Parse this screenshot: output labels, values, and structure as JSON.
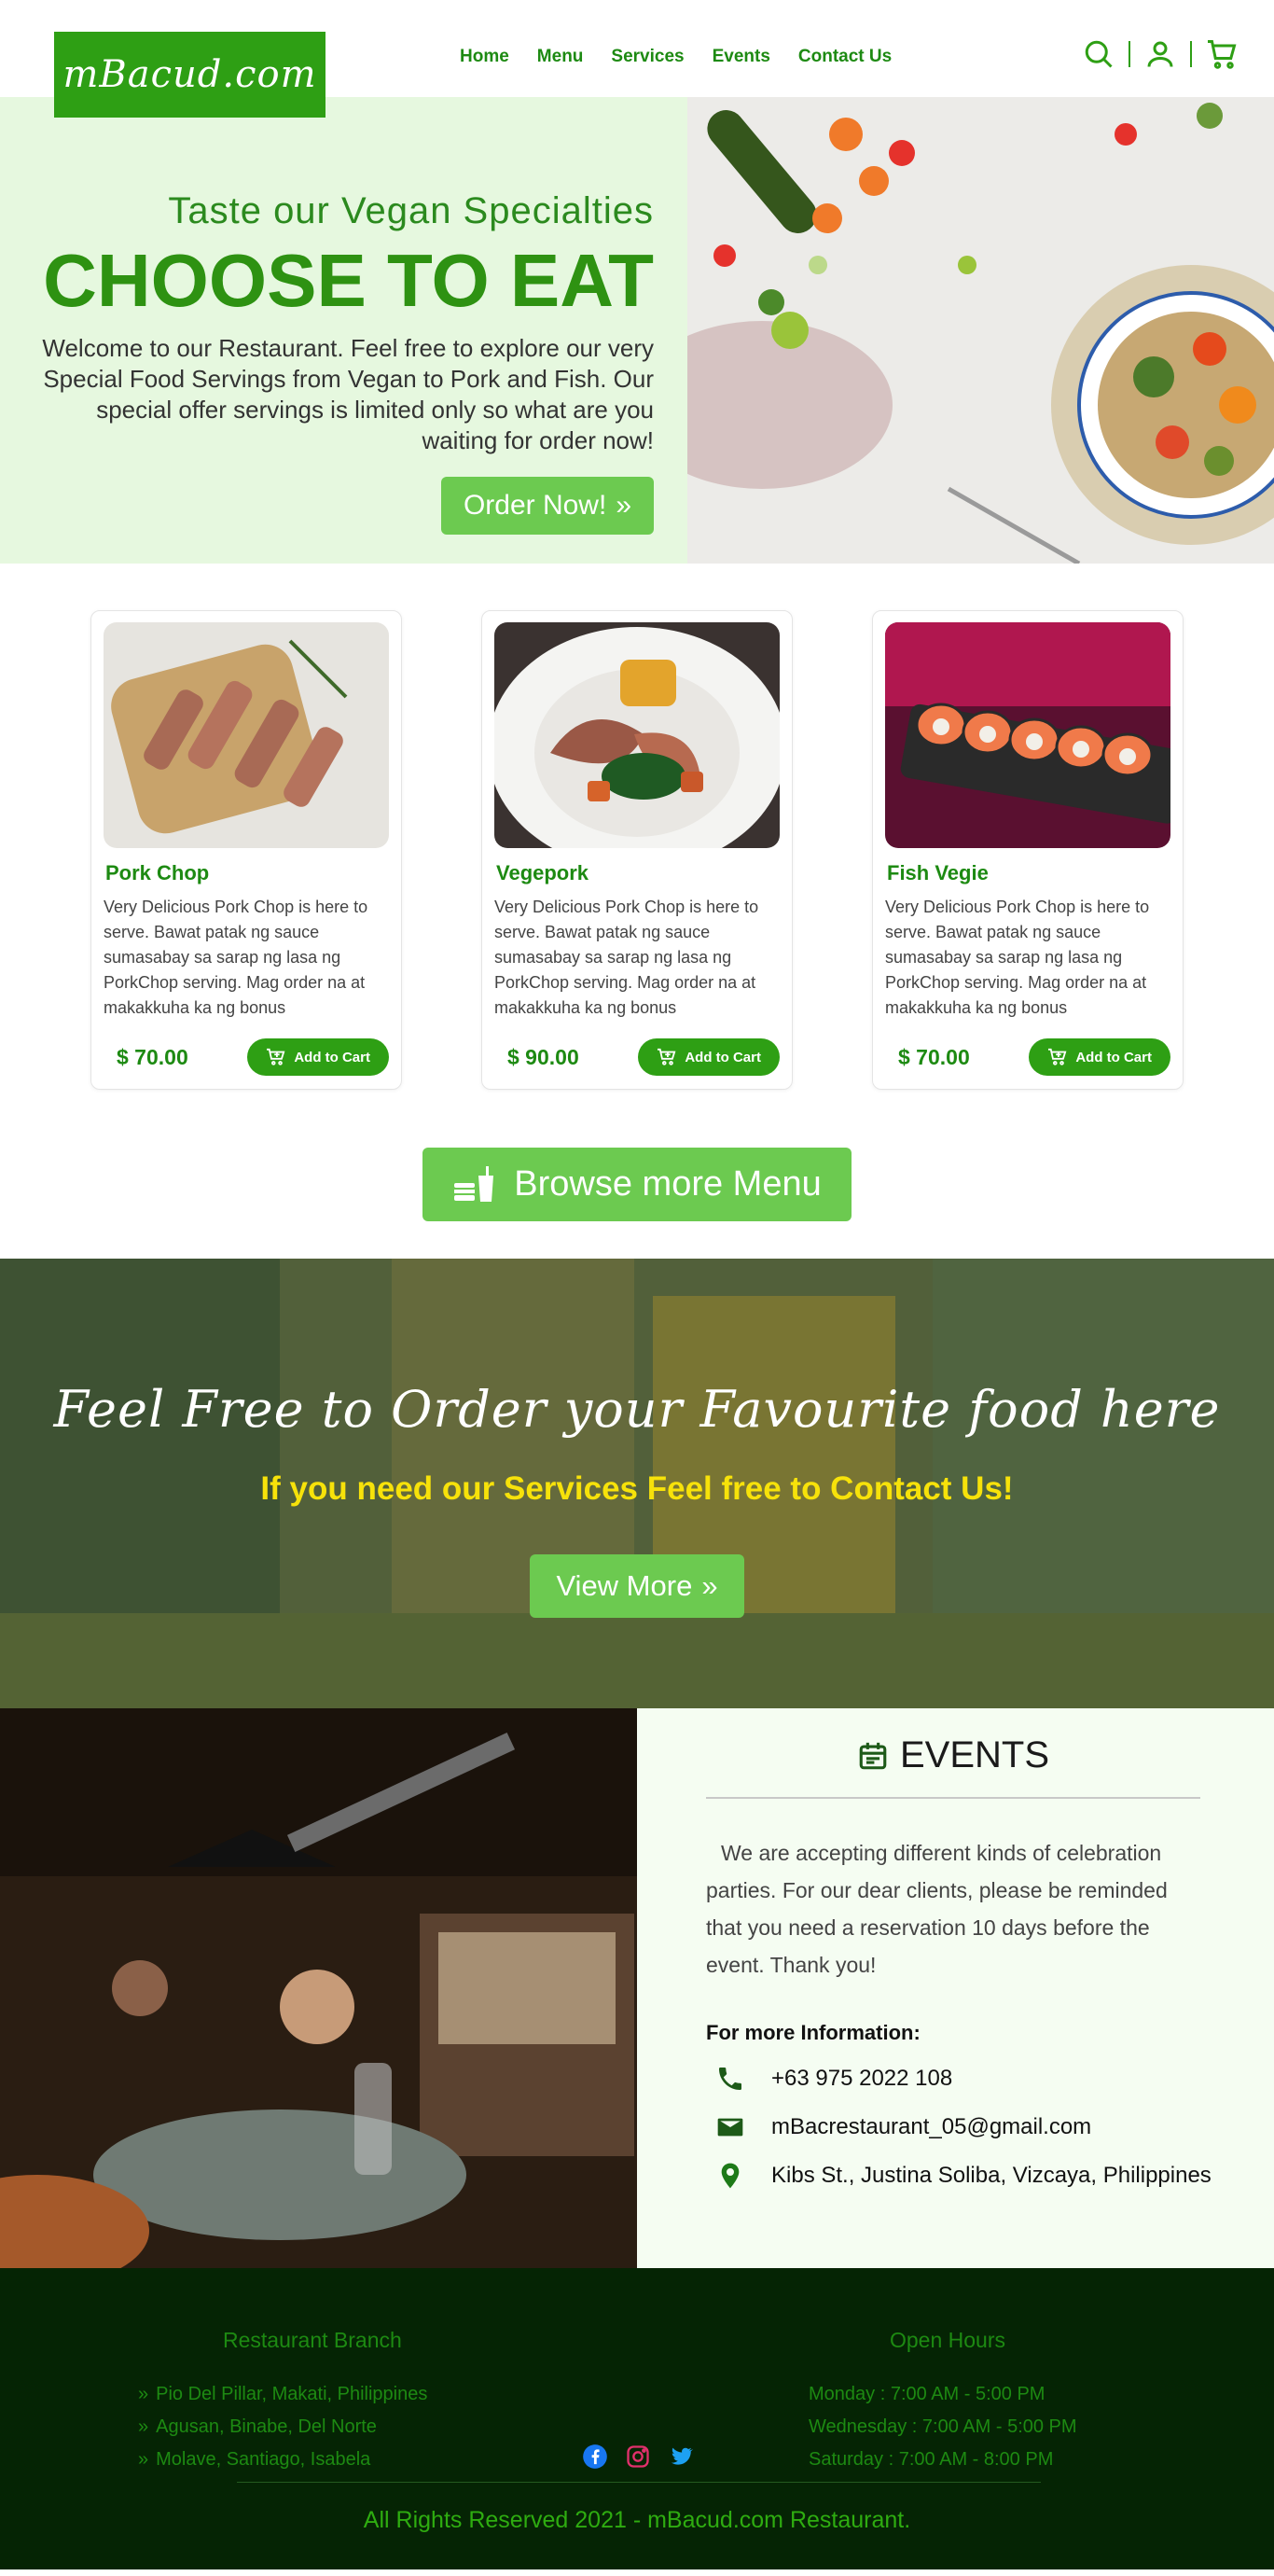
{
  "brand": {
    "logo_text": "mBacud.com"
  },
  "nav": {
    "links": [
      "Home",
      "Menu",
      "Services",
      "Events",
      "Contact Us"
    ]
  },
  "hero": {
    "subtitle": "Taste our Vegan Specialties",
    "title": "CHOOSE TO EAT",
    "text": "Welcome to our Restaurant. Feel free to explore our very Special Food Servings from Vegan to Pork and Fish. Our special offer servings is limited only so what are you waiting for order now!",
    "order_label": "Order Now!"
  },
  "cards": [
    {
      "title": "Pork Chop",
      "desc": "Very Delicious Pork Chop is here to serve. Bawat patak ng sauce sumasabay sa sarap ng lasa ng PorkChop serving. Mag order na at makakkuha ka ng bonus",
      "price": "$ 70.00",
      "cart_label": "Add to Cart"
    },
    {
      "title": "Vegepork",
      "desc": "Very Delicious Pork Chop is here to serve. Bawat patak ng sauce sumasabay sa sarap ng lasa ng PorkChop serving. Mag order na at makakkuha ka ng bonus",
      "price": "$ 90.00",
      "cart_label": "Add to Cart"
    },
    {
      "title": "Fish Vegie",
      "desc": "Very Delicious Pork Chop is here to serve. Bawat patak ng sauce sumasabay sa sarap ng lasa ng PorkChop serving. Mag order na at makakkuha ka ng bonus",
      "price": "$ 70.00",
      "cart_label": "Add to Cart"
    }
  ],
  "browse": {
    "label": "Browse more Menu"
  },
  "banner": {
    "script": "Feel Free to Order your Favourite food here",
    "sub": "If you need our Services Feel free to Contact Us!",
    "view_label": "View More"
  },
  "events": {
    "title": "EVENTS",
    "text": "We are accepting different kinds of celebration parties. For our dear clients, please be reminded that you need a reservation 10 days before the event. Thank you!",
    "info_label": "For more Information:",
    "phone": "+63 975 2022 108",
    "email": "mBacrestaurant_05@gmail.com",
    "address": "Kibs St., Justina Soliba, Vizcaya, Philippines"
  },
  "footer": {
    "branch_title": "Restaurant Branch",
    "branches": [
      "Pio Del Pillar, Makati, Philippines",
      "Agusan, Binabe, Del Norte",
      "Molave, Santiago, Isabela"
    ],
    "hours_title": "Open Hours",
    "hours": [
      "Monday : 7:00 AM - 5:00 PM",
      "Wednesday : 7:00 AM - 5:00 PM",
      "Saturday : 7:00 AM - 8:00 PM"
    ],
    "copyright": "All Rights Reserved 2021 -  mBacud.com Restaurant."
  },
  "colors": {
    "primary": "#2e9f14",
    "accent": "#6cca50",
    "hero_bg": "#e6f8df",
    "footer_bg": "#052404",
    "banner_highlight": "#f7e20a"
  }
}
